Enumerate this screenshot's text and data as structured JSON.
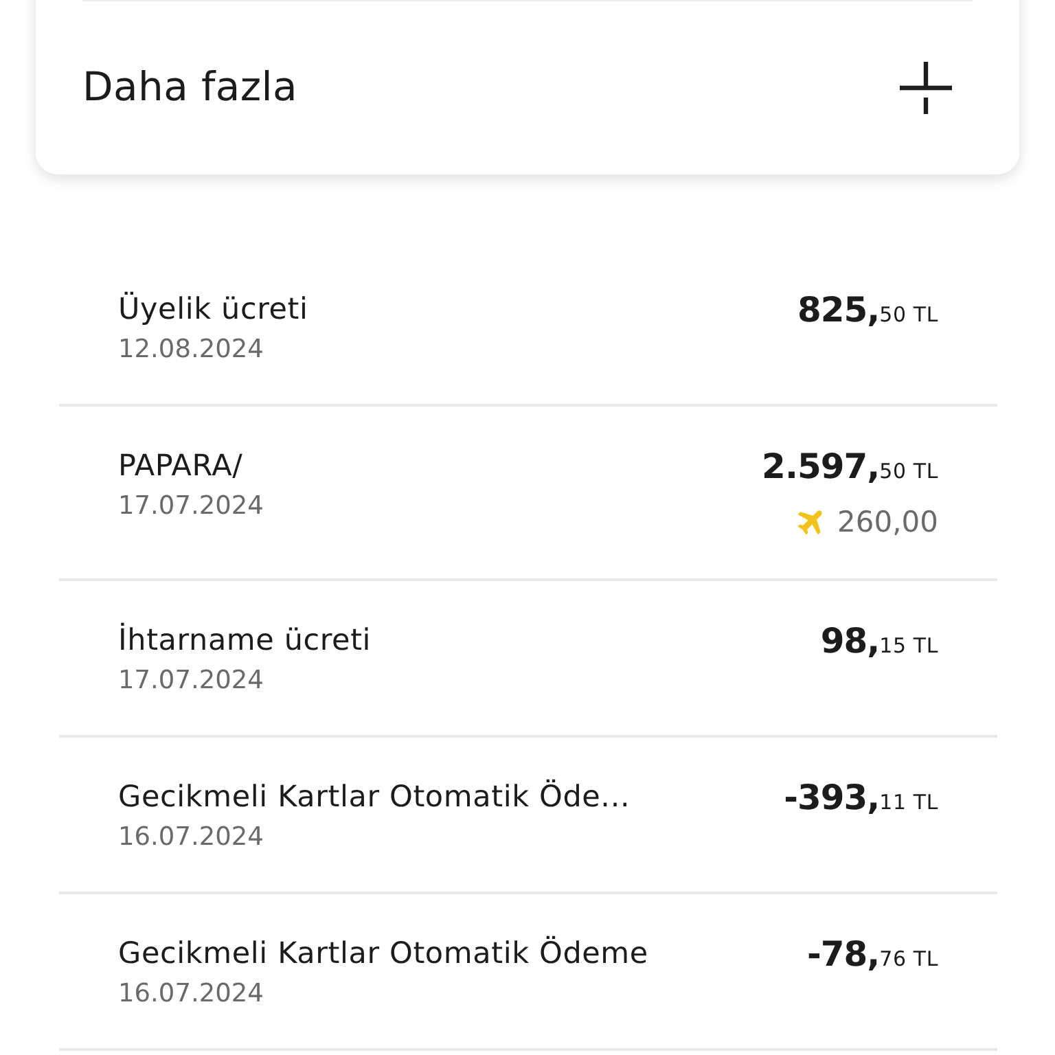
{
  "more_section": {
    "label": "Daha fazla",
    "expanded": false
  },
  "transactions": [
    {
      "title": "Üyelik ücreti",
      "date": "12.08.2024",
      "amount": "825,",
      "amount_small": "50 TL"
    },
    {
      "title": "PAPARA/",
      "date": "17.07.2024",
      "amount": "2.597,",
      "amount_small": "50 TL",
      "reward": "260,00"
    },
    {
      "title": "İhtarname ücreti",
      "date": "17.07.2024",
      "amount": "98,",
      "amount_small": "15 TL"
    },
    {
      "title": "Gecikmeli Kartlar Otomatik Öde...",
      "date": "16.07.2024",
      "amount": "-393,",
      "amount_small": "11 TL"
    },
    {
      "title": "Gecikmeli Kartlar Otomatik Ödeme",
      "date": "16.07.2024",
      "amount": "-78,",
      "amount_small": "76 TL"
    }
  ]
}
